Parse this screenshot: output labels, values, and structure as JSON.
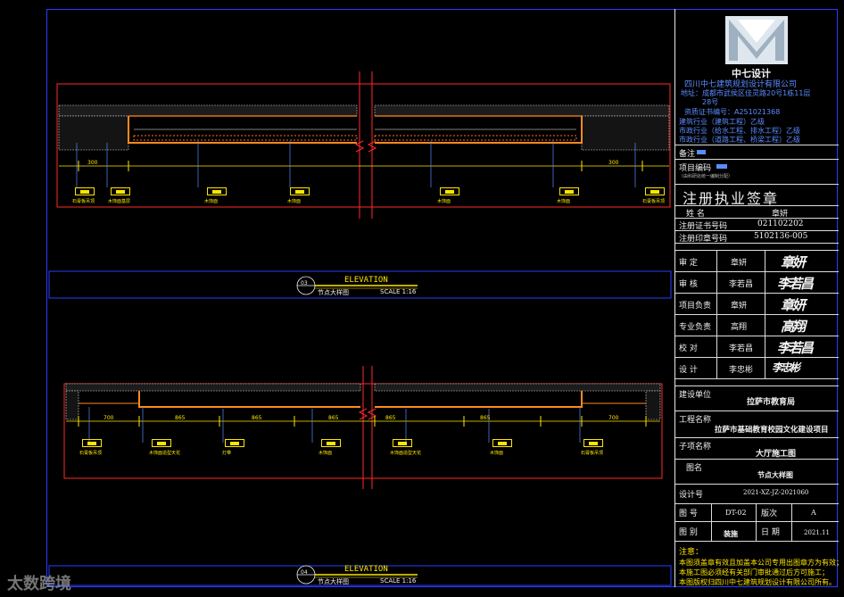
{
  "company": {
    "logo_text": "中七设计",
    "name": "四川中七建筑规划设计有限公司",
    "address_line1": "地址：成都市武侯区佳灵路20号1栋11层",
    "address_line2": "28号",
    "cert": "资质证书编号：A251021368",
    "qual1": "建筑行业（建筑工程）乙级",
    "qual2": "市政行业（给水工程、排水工程）乙级",
    "qual3": "市政行业（道路工程、桥梁工程）乙级"
  },
  "titleblock": {
    "remarks_label": "备注",
    "project_code_label": "项目编码",
    "project_code_sub": "（由科研处统一编制分配）",
    "seal_title": "注册执业签章",
    "name_label": "姓    名",
    "name_value": "章妍",
    "cert_no_label": "注册证书号码",
    "cert_no_value": "021102202",
    "seal_no_label": "注册印章号码",
    "seal_no_value": "5102136-005",
    "roles": [
      {
        "label": "审    定",
        "name": "章妍",
        "sig": "章妍"
      },
      {
        "label": "审    核",
        "name": "李若昌",
        "sig": "李若昌"
      },
      {
        "label": "项目负责",
        "name": "章妍",
        "sig": "章妍"
      },
      {
        "label": "专业负责",
        "name": "高翔",
        "sig": "高翔"
      },
      {
        "label": "校    对",
        "name": "李若昌",
        "sig": "李若昌"
      },
      {
        "label": "设    计",
        "name": "李忠彬",
        "sig": "李忠彬"
      }
    ],
    "client_label": "建设单位",
    "client_value": "拉萨市教育局",
    "project_label": "工程名称",
    "project_value": "拉萨市基础教育校园文化建设项目",
    "subproject_label": "子项名称",
    "subproject_value": "大厅施工图",
    "drawing_label": "图名",
    "drawing_value": "节点大样图",
    "design_no_label": "设计号",
    "design_no_value": "2021-XZ-JZ-2021060",
    "sheet_label": "图    号",
    "sheet_value": "DT-02",
    "version_label": "版次",
    "version_value": "A",
    "category_label": "图    别",
    "category_value": "装施",
    "date_label": "日    期",
    "date_value": "2021.11",
    "notes_label": "注意：",
    "notes": [
      "本图须盖章有效且加盖本公司专用出图章方为有效；",
      "本施工图必须经有关部门审批通过后方可施工；",
      "本图版权归四川中七建筑规划设计有限公司所有。"
    ]
  },
  "views": [
    {
      "number": "03",
      "title": "ELEVATION",
      "subtitle": "节点大样图",
      "scale": "SCALE 1:16",
      "dims": [
        "300",
        "300"
      ],
      "tags": [
        "石膏板吊顶",
        "木饰面基层",
        "木饰面",
        "木饰面",
        "木饰面",
        "木饰面",
        "石膏板吊顶"
      ]
    },
    {
      "number": "04",
      "title": "ELEVATION",
      "subtitle": "节点大样图",
      "scale": "SCALE 1:16",
      "dims": [
        "700",
        "865",
        "865",
        "865",
        "865",
        "865",
        "700"
      ],
      "tags": [
        "石膏板吊顶",
        "木饰面造型天花",
        "灯带",
        "木饰面",
        "木饰面造型天花",
        "木饰面",
        "石膏板吊顶"
      ]
    }
  ],
  "watermark": "太数跨境"
}
